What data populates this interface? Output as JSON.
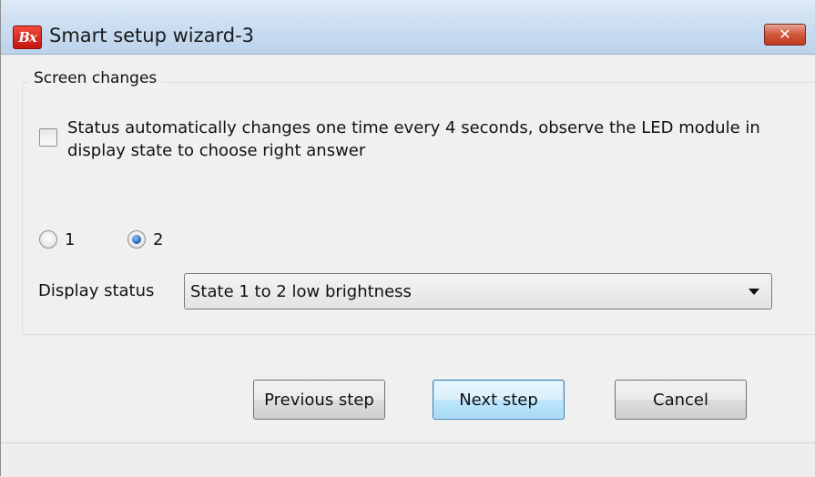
{
  "window": {
    "title": "Smart setup wizard-3",
    "icon_text": "Bx",
    "close_symbol": "✕"
  },
  "group": {
    "title": "Screen changes",
    "checkbox_label": "Status automatically changes one time every 4 seconds, observe the LED module in display state to choose right answer",
    "checkbox_checked": false
  },
  "radios": [
    {
      "label": "1",
      "checked": false
    },
    {
      "label": "2",
      "checked": true
    }
  ],
  "display_status": {
    "label": "Display status",
    "selected": "State 1 to 2 low brightness"
  },
  "buttons": {
    "previous": "Previous step",
    "next": "Next step",
    "cancel": "Cancel"
  },
  "colors": {
    "accent": "#3c7fb1",
    "titlebar": "#c9dcf0",
    "close_button": "#c23a20"
  }
}
